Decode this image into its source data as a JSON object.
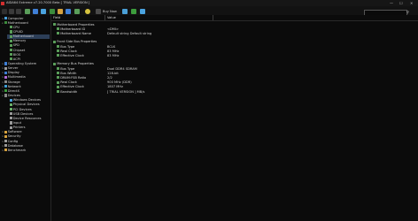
{
  "window": {
    "title": "AIDA64 Extreme v7.20.7000 Beta [ TRIAL VERSION ]",
    "controls": [
      "—",
      "☐",
      "✕"
    ]
  },
  "toolbar": {
    "buy_now": "Buy Now",
    "search_placeholder": "",
    "search_icon": "search-icon"
  },
  "sidebar": {
    "items": [
      {
        "label": "Computer",
        "level": 0,
        "expander": ">",
        "icon": "computer-icon",
        "color": "#4aa3df"
      },
      {
        "label": "Motherboard",
        "level": 0,
        "expander": "v",
        "icon": "motherboard-icon",
        "color": "#3c8c3c"
      },
      {
        "label": "CPU",
        "level": 1,
        "expander": "",
        "icon": "cpu-icon",
        "color": "#5a9e5a"
      },
      {
        "label": "CPUID",
        "level": 1,
        "expander": "",
        "icon": "cpuid-icon",
        "color": "#5a9e5a"
      },
      {
        "label": "Motherboard",
        "level": 1,
        "expander": "",
        "icon": "motherboard-icon",
        "color": "#5a9e5a",
        "selected": true
      },
      {
        "label": "Memory",
        "level": 1,
        "expander": "",
        "icon": "memory-icon",
        "color": "#5a9e5a"
      },
      {
        "label": "SPD",
        "level": 1,
        "expander": "",
        "icon": "spd-icon",
        "color": "#5a9e5a"
      },
      {
        "label": "Chipset",
        "level": 1,
        "expander": "",
        "icon": "chipset-icon",
        "color": "#5a9e5a"
      },
      {
        "label": "BIOS",
        "level": 1,
        "expander": "",
        "icon": "bios-icon",
        "color": "#5a9e5a"
      },
      {
        "label": "ACPI",
        "level": 1,
        "expander": "",
        "icon": "acpi-icon",
        "color": "#5a9e5a"
      },
      {
        "label": "Operating System",
        "level": 0,
        "expander": ">",
        "icon": "windows-icon",
        "color": "#3f7fd6"
      },
      {
        "label": "Server",
        "level": 0,
        "expander": ">",
        "icon": "server-icon",
        "color": "#9a9a9a"
      },
      {
        "label": "Display",
        "level": 0,
        "expander": ">",
        "icon": "display-icon",
        "color": "#3f7fd6"
      },
      {
        "label": "Multimedia",
        "level": 0,
        "expander": ">",
        "icon": "multimedia-icon",
        "color": "#b06ad6"
      },
      {
        "label": "Storage",
        "level": 0,
        "expander": ">",
        "icon": "storage-icon",
        "color": "#8a8a8a"
      },
      {
        "label": "Network",
        "level": 0,
        "expander": ">",
        "icon": "network-icon",
        "color": "#3f9fd6"
      },
      {
        "label": "DirectX",
        "level": 0,
        "expander": ">",
        "icon": "directx-icon",
        "color": "#3c9c3c"
      },
      {
        "label": "Devices",
        "level": 0,
        "expander": "v",
        "icon": "devices-icon",
        "color": "#8a8a8a"
      },
      {
        "label": "Windows Devices",
        "level": 1,
        "expander": "",
        "icon": "windows-devices-icon",
        "color": "#4aa3df"
      },
      {
        "label": "Physical Devices",
        "level": 1,
        "expander": "",
        "icon": "physical-devices-icon",
        "color": "#6bb36b"
      },
      {
        "label": "PCI Devices",
        "level": 1,
        "expander": "",
        "icon": "pci-devices-icon",
        "color": "#6bb36b"
      },
      {
        "label": "USB Devices",
        "level": 1,
        "expander": "",
        "icon": "usb-devices-icon",
        "color": "#9a9a9a"
      },
      {
        "label": "Device Resources",
        "level": 1,
        "expander": "",
        "icon": "device-resources-icon",
        "color": "#9a9a9a"
      },
      {
        "label": "Input",
        "level": 1,
        "expander": "",
        "icon": "input-icon",
        "color": "#9a9a9a"
      },
      {
        "label": "Printers",
        "level": 1,
        "expander": "",
        "icon": "printers-icon",
        "color": "#9a9a9a"
      },
      {
        "label": "Software",
        "level": 0,
        "expander": ">",
        "icon": "software-icon",
        "color": "#d6a23f"
      },
      {
        "label": "Security",
        "level": 0,
        "expander": ">",
        "icon": "security-icon",
        "color": "#d6a23f"
      },
      {
        "label": "Config",
        "level": 0,
        "expander": ">",
        "icon": "config-icon",
        "color": "#9a9a9a"
      },
      {
        "label": "Database",
        "level": 0,
        "expander": ">",
        "icon": "database-icon",
        "color": "#9a9a9a"
      },
      {
        "label": "Benchmark",
        "level": 0,
        "expander": ">",
        "icon": "benchmark-icon",
        "color": "#d6a23f"
      }
    ]
  },
  "main": {
    "columns": [
      "Field",
      "Value"
    ],
    "rows": [
      {
        "type": "section",
        "field": "Motherboard Properties",
        "value": "",
        "icon": "motherboard-icon",
        "color": "#5a9e5a"
      },
      {
        "type": "item",
        "field": "Motherboard ID",
        "value": "<DMI>",
        "icon": "motherboard-icon",
        "color": "#5a9e5a"
      },
      {
        "type": "item",
        "field": "Motherboard Name",
        "value": "Default string Default string",
        "icon": "motherboard-icon",
        "color": "#5a9e5a"
      },
      {
        "type": "gap"
      },
      {
        "type": "section",
        "field": "Front Side Bus Properties",
        "value": "",
        "icon": "bus-icon",
        "color": "#5a9e5a"
      },
      {
        "type": "item",
        "field": "Bus Type",
        "value": "BCLK",
        "icon": "bus-icon",
        "color": "#5a9e5a"
      },
      {
        "type": "item",
        "field": "Real Clock",
        "value": "83 MHz",
        "icon": "bus-icon",
        "color": "#5a9e5a"
      },
      {
        "type": "item",
        "field": "Effective Clock",
        "value": "83 MHz",
        "icon": "bus-icon",
        "color": "#5a9e5a"
      },
      {
        "type": "gap"
      },
      {
        "type": "section",
        "field": "Memory Bus Properties",
        "value": "",
        "icon": "memory-icon",
        "color": "#5a9e5a"
      },
      {
        "type": "item",
        "field": "Bus Type",
        "value": "Dual DDR4 SDRAM",
        "icon": "memory-icon",
        "color": "#5a9e5a"
      },
      {
        "type": "item",
        "field": "Bus Width",
        "value": "128-bit",
        "icon": "memory-icon",
        "color": "#5a9e5a"
      },
      {
        "type": "item",
        "field": "DRAM:FSB Ratio",
        "value": "2/2",
        "icon": "memory-icon",
        "color": "#5a9e5a"
      },
      {
        "type": "item",
        "field": "Real Clock",
        "value": "900 MHz (DDR)",
        "icon": "memory-icon",
        "color": "#5a9e5a"
      },
      {
        "type": "item",
        "field": "Effective Clock",
        "value": "1807 MHz",
        "icon": "memory-icon",
        "color": "#5a9e5a"
      },
      {
        "type": "item",
        "field": "Bandwidth",
        "value": "[ TRIAL VERSION ] MB/s",
        "icon": "memory-icon",
        "color": "#5a9e5a"
      }
    ]
  }
}
